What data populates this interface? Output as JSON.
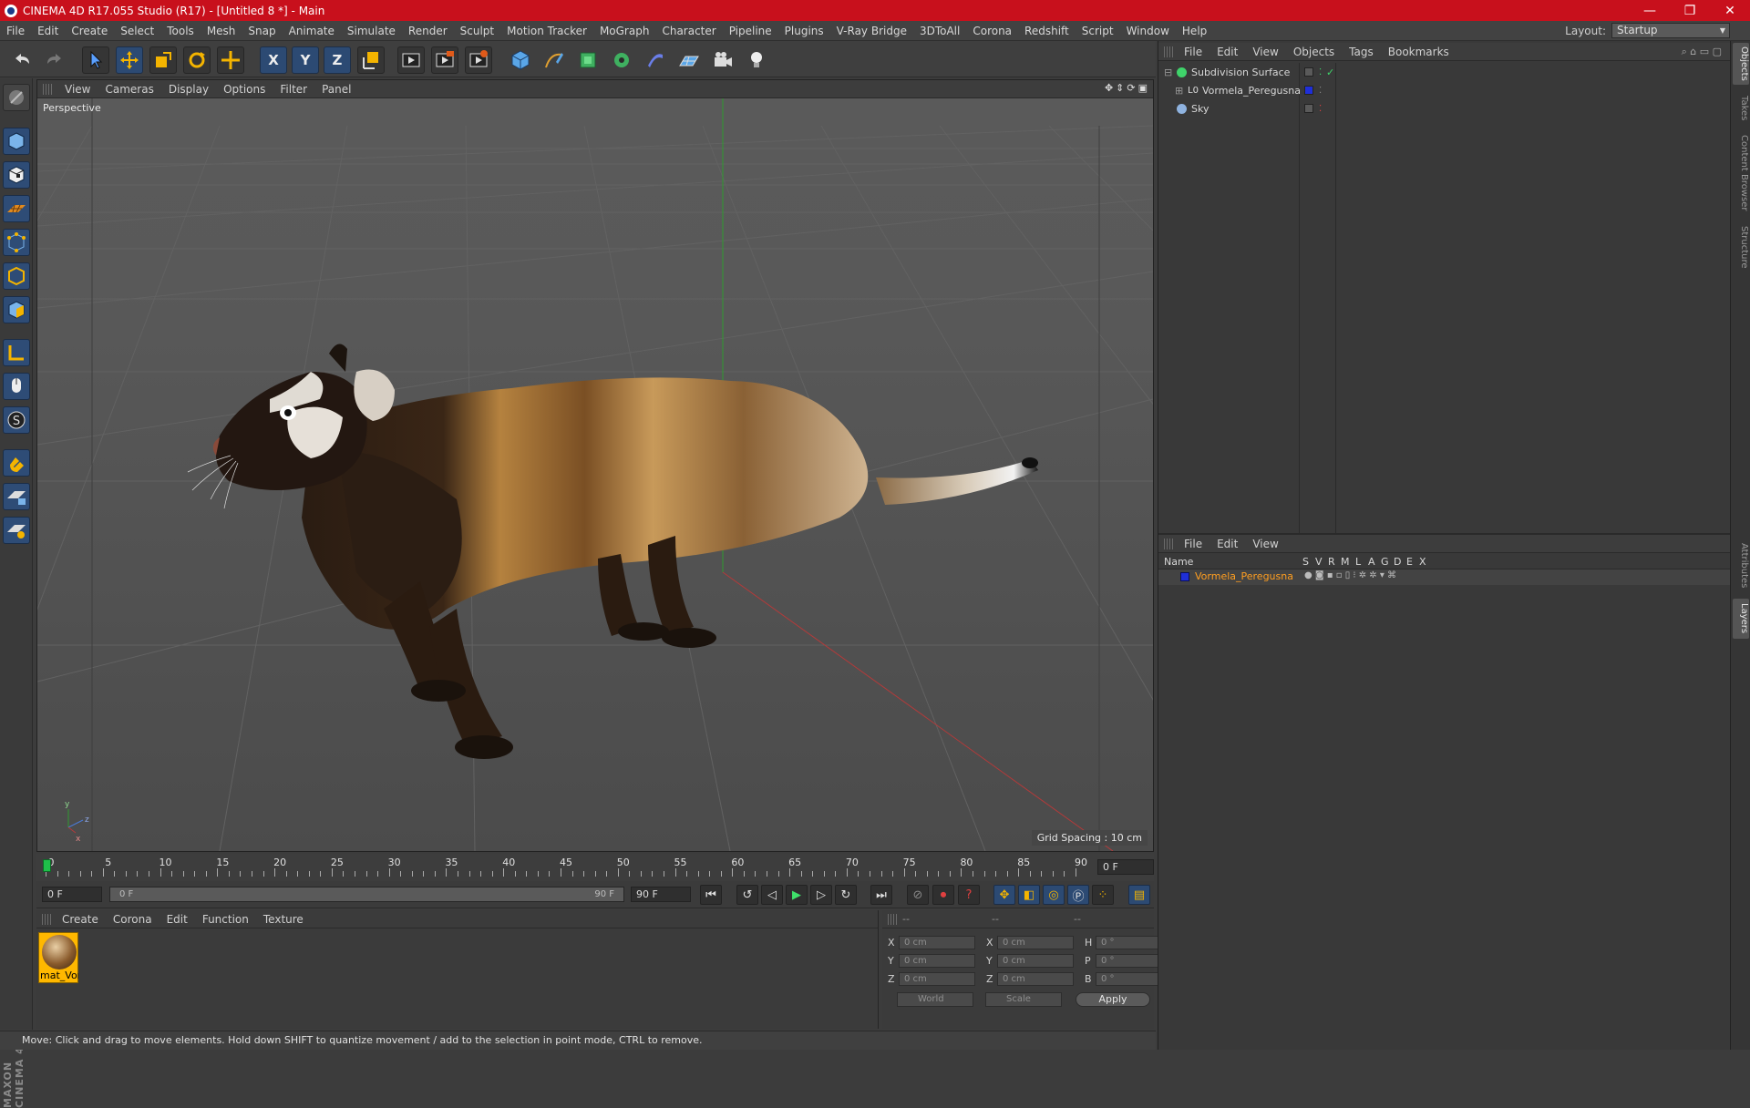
{
  "window": {
    "title": "CINEMA 4D R17.055 Studio (R17) - [Untitled 8 *] - Main",
    "minimize": "—",
    "restore": "❐",
    "close": "✕"
  },
  "menu": [
    "File",
    "Edit",
    "Create",
    "Select",
    "Tools",
    "Mesh",
    "Snap",
    "Animate",
    "Simulate",
    "Render",
    "Sculpt",
    "Motion Tracker",
    "MoGraph",
    "Character",
    "Pipeline",
    "Plugins",
    "V-Ray Bridge",
    "3DToAll",
    "Corona",
    "Redshift",
    "Script",
    "Window",
    "Help"
  ],
  "layout": {
    "label": "Layout:",
    "value": "Startup"
  },
  "toolbar": {
    "x_label": "X",
    "y_label": "Y",
    "z_label": "Z"
  },
  "viewport": {
    "menu": [
      "View",
      "Cameras",
      "Display",
      "Options",
      "Filter",
      "Panel"
    ],
    "label": "Perspective",
    "grid_spacing": "Grid Spacing : 10 cm",
    "axis_y": "y",
    "axis_z": "z",
    "axis_x": "x"
  },
  "timeline": {
    "ticks": [
      "0",
      "5",
      "10",
      "15",
      "20",
      "25",
      "30",
      "35",
      "40",
      "45",
      "50",
      "55",
      "60",
      "65",
      "70",
      "75",
      "80",
      "85",
      "90"
    ],
    "current_frame": "0 F",
    "start_field": "0 F",
    "slider_start": "0 F",
    "slider_end": "90 F",
    "end_field": "90 F"
  },
  "materials": {
    "menu": [
      "Create",
      "Corona",
      "Edit",
      "Function",
      "Texture"
    ],
    "items": [
      {
        "name": "mat_Vor"
      }
    ]
  },
  "coordinates": {
    "headers": [
      "--",
      "--",
      "--"
    ],
    "rows": [
      {
        "a": "X",
        "av": "0 cm",
        "b": "X",
        "bv": "0 cm",
        "c": "H",
        "cv": "0 °"
      },
      {
        "a": "Y",
        "av": "0 cm",
        "b": "Y",
        "bv": "0 cm",
        "c": "P",
        "cv": "0 °"
      },
      {
        "a": "Z",
        "av": "0 cm",
        "b": "Z",
        "bv": "0 cm",
        "c": "B",
        "cv": "0 °"
      }
    ],
    "space": "World",
    "mode": "Scale",
    "apply": "Apply"
  },
  "objects": {
    "menu": [
      "File",
      "Edit",
      "View",
      "Objects",
      "Tags",
      "Bookmarks"
    ],
    "items": [
      {
        "name": "Subdivision Surface",
        "color": "#3fd36a"
      },
      {
        "name": "Vormela_Peregusna",
        "color": "#d8d8d8"
      },
      {
        "name": "Sky",
        "color": "#8fb3e0"
      }
    ]
  },
  "layers": {
    "menu": [
      "File",
      "Edit",
      "View"
    ],
    "header_name": "Name",
    "cols": [
      "S",
      "V",
      "R",
      "M",
      "L",
      "A",
      "G",
      "D",
      "E",
      "X"
    ],
    "items": [
      {
        "name": "Vormela_Peregusna",
        "color": "#1f2fd8"
      }
    ]
  },
  "side_tabs": [
    "Objects",
    "Takes",
    "Content Browser",
    "Structure",
    "Attributes",
    "Layers"
  ],
  "branding": "MAXON CINEMA 4D",
  "status": "Move: Click and drag to move elements. Hold down SHIFT to quantize movement / add to the selection in point mode, CTRL to remove."
}
